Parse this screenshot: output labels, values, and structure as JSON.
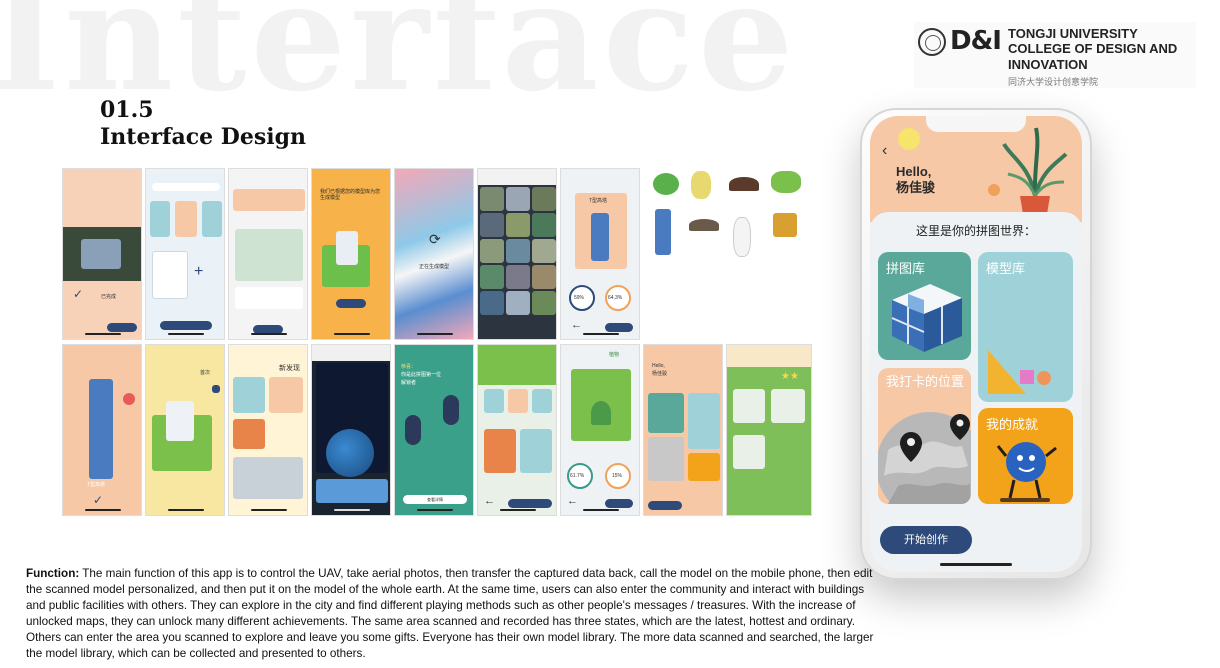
{
  "watermark": "Interface",
  "section": {
    "number": "01.5",
    "title": "Interface Design"
  },
  "brand": {
    "logo_mark": "D&I",
    "line1": "TONGJI UNIVERSITY",
    "line2": "COLLEGE OF DESIGN AND",
    "line3": "INNOVATION",
    "chinese": "同济大学设计创意学院"
  },
  "screens": {
    "s1": {
      "label": "已完成"
    },
    "s4": {
      "text": "我们已根据您的模型库为您生成模型"
    },
    "s5": {
      "label": "正在生成模型"
    },
    "s7": {
      "name": "T型高塔",
      "p1": "59%",
      "p2": "64.3%"
    },
    "s9": {
      "label": "T型高塔"
    },
    "s10": {
      "label": "首次"
    },
    "s11": {
      "label": "新发现"
    },
    "s13": {
      "line1": "恭喜：",
      "line2": "你是此拼图第一位",
      "line3": "解锁者",
      "button": "查看详情"
    },
    "s15": {
      "label": "植物",
      "p1": "61.7%",
      "p2": "15%"
    },
    "s16": {
      "hello": "Hello,",
      "name": "杨佳骏"
    }
  },
  "phone": {
    "greeting": "Hello,",
    "name": "杨佳骏",
    "world_title": "这里是你的拼图世界：",
    "tiles": {
      "puzzle_library": "拼图库",
      "model_library": "模型库",
      "checkin_location": "我打卡的位置",
      "achievements": "我的成就"
    },
    "start_button": "开始创作"
  },
  "function": {
    "label": "Function:",
    "text": "The main function of this app is to control the UAV, take aerial photos, then transfer the captured data back, call the model on the mobile phone, then edit the scanned model personalized, and then put it on the model of the whole earth. At the same time, users can also enter the community and interact with buildings and public facilities with others. They can explore in the city and find different playing methods such as other people's messages / treasures. With the increase of unlocked maps, they can unlock many different achievements. The same area scanned and recorded has three states, which are the latest, hottest and ordinary. Others can enter the area you scanned to explore and leave you some gifts. Everyone has their own model library. The more data scanned and searched, the larger the model library, which can be collected and presented to others."
  },
  "colors": {
    "peach": "#f6c8a6",
    "teal": "#5aa89a",
    "light_teal": "#9ed2d8",
    "orange": "#f2a31a",
    "navy": "#2e4a7a",
    "green": "#7fbf5a"
  }
}
